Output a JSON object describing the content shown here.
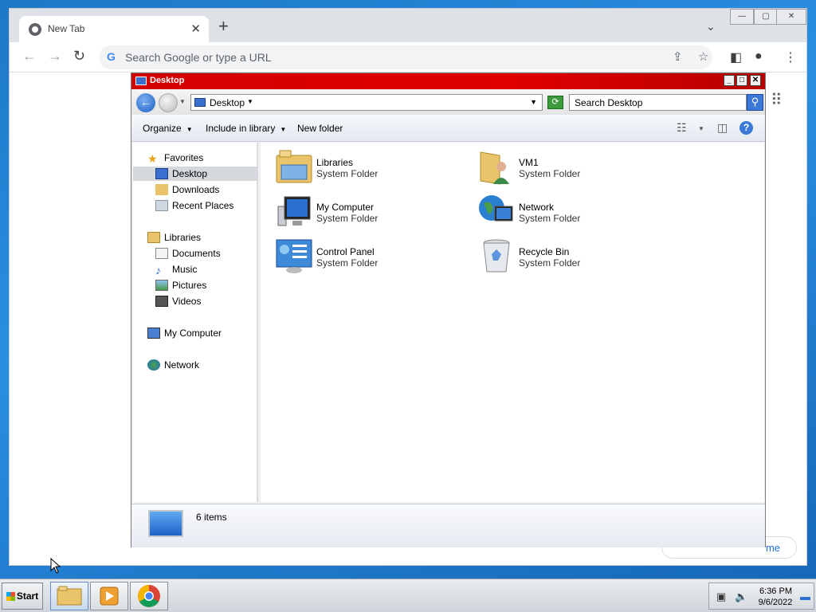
{
  "browser": {
    "tab_title": "New Tab",
    "tab_close": "✕",
    "new_tab": "+",
    "tab_search": "⌄",
    "omnibox_placeholder": "Search Google or type a URL",
    "window_controls": [
      "—",
      "▢",
      "✕"
    ],
    "hidden_link_fragment": "me"
  },
  "explorer": {
    "title": "Desktop",
    "window_controls": [
      "_",
      "□",
      "✕"
    ],
    "address": "Desktop",
    "search_placeholder": "Search Desktop",
    "toolbar": {
      "organize": "Organize",
      "include_in_library": "Include in library",
      "new_folder": "New folder"
    },
    "nav": {
      "favorites": "Favorites",
      "desktop": "Desktop",
      "downloads": "Downloads",
      "recent_places": "Recent Places",
      "libraries": "Libraries",
      "documents": "Documents",
      "music": "Music",
      "pictures": "Pictures",
      "videos": "Videos",
      "my_computer": "My Computer",
      "network": "Network"
    },
    "items": [
      {
        "name": "Libraries",
        "type": "System Folder",
        "icon": "libraries-icon"
      },
      {
        "name": "VM1",
        "type": "System Folder",
        "icon": "user-folder-icon"
      },
      {
        "name": "My Computer",
        "type": "System Folder",
        "icon": "computer-icon"
      },
      {
        "name": "Network",
        "type": "System Folder",
        "icon": "network-icon"
      },
      {
        "name": "Control Panel",
        "type": "System Folder",
        "icon": "control-panel-icon"
      },
      {
        "name": "Recycle Bin",
        "type": "System Folder",
        "icon": "recycle-bin-icon"
      }
    ],
    "status": "6 items"
  },
  "taskbar": {
    "start_label": "Start",
    "time": "6:36 PM",
    "date": "9/6/2022"
  },
  "colors": {
    "explorer_titlebar": "#d40000",
    "desktop_bg": "#1d78c8",
    "chrome_tabbar": "#dee1e6"
  }
}
